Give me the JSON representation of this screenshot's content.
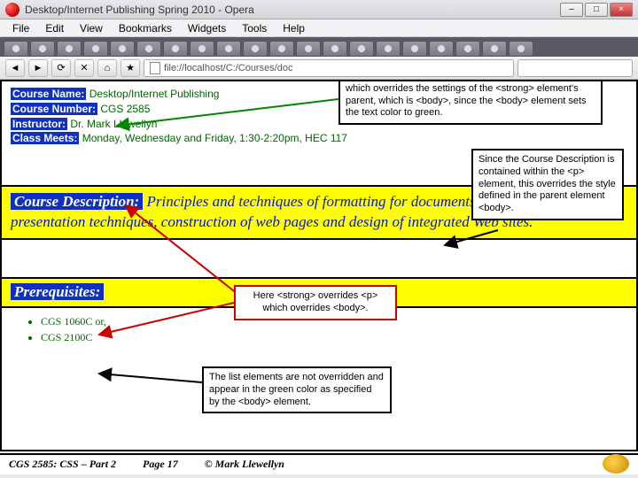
{
  "window": {
    "title": "Desktop/Internet Publishing Spring 2010 - Opera",
    "min": "–",
    "max": "□",
    "close": "×"
  },
  "menu": {
    "file": "File",
    "edit": "Edit",
    "view": "View",
    "bookmarks": "Bookmarks",
    "widgets": "Widgets",
    "tools": "Tools",
    "help": "Help"
  },
  "nav": {
    "back": "◄",
    "fwd": "►",
    "reload": "⟳",
    "stop": "✕",
    "home": "⌂",
    "wand": "★",
    "url": "file://localhost/C:/Courses/doc"
  },
  "course": {
    "name_lbl": "Course Name:",
    "name_val": " Desktop/Internet Publishing",
    "num_lbl": "Course Number:",
    "num_val": " CGS 2585",
    "instr_lbl": "Instructor:",
    "instr_val": " Dr. Mark Llewellyn",
    "meets_lbl": "Class Meets:",
    "meets_val": " Monday, Wednesday and Friday, 1:30-2:20pm, HEC 117"
  },
  "desc": {
    "lbl": "Course Description:",
    "text": " Principles and techniques of formatting for documents and newsletters, presentation techniques, construction of web pages and design of integrated Web sites."
  },
  "prereq": {
    "lbl": "Prerequisites:",
    "items": [
      "CGS 1060C or,",
      "CGS 2100C"
    ]
  },
  "callouts": {
    "c1": "Notice that all text within the <strong> elements is white which overrides the settings of the <strong> element's parent, which is <body>, since the <body> element sets the text color to green.",
    "c2": "Since the Course Description is contained within the <p> element, this overrides the style defined in the parent element <body>.",
    "c3": "Here <strong> overrides <p> which overrides <body>.",
    "c4": "The list elements are not overridden and appear in the green color as specified by the <body>  element."
  },
  "footer": {
    "left": "CGS 2585: CSS – Part 2",
    "mid": "Page 17",
    "right": "© Mark Llewellyn"
  }
}
